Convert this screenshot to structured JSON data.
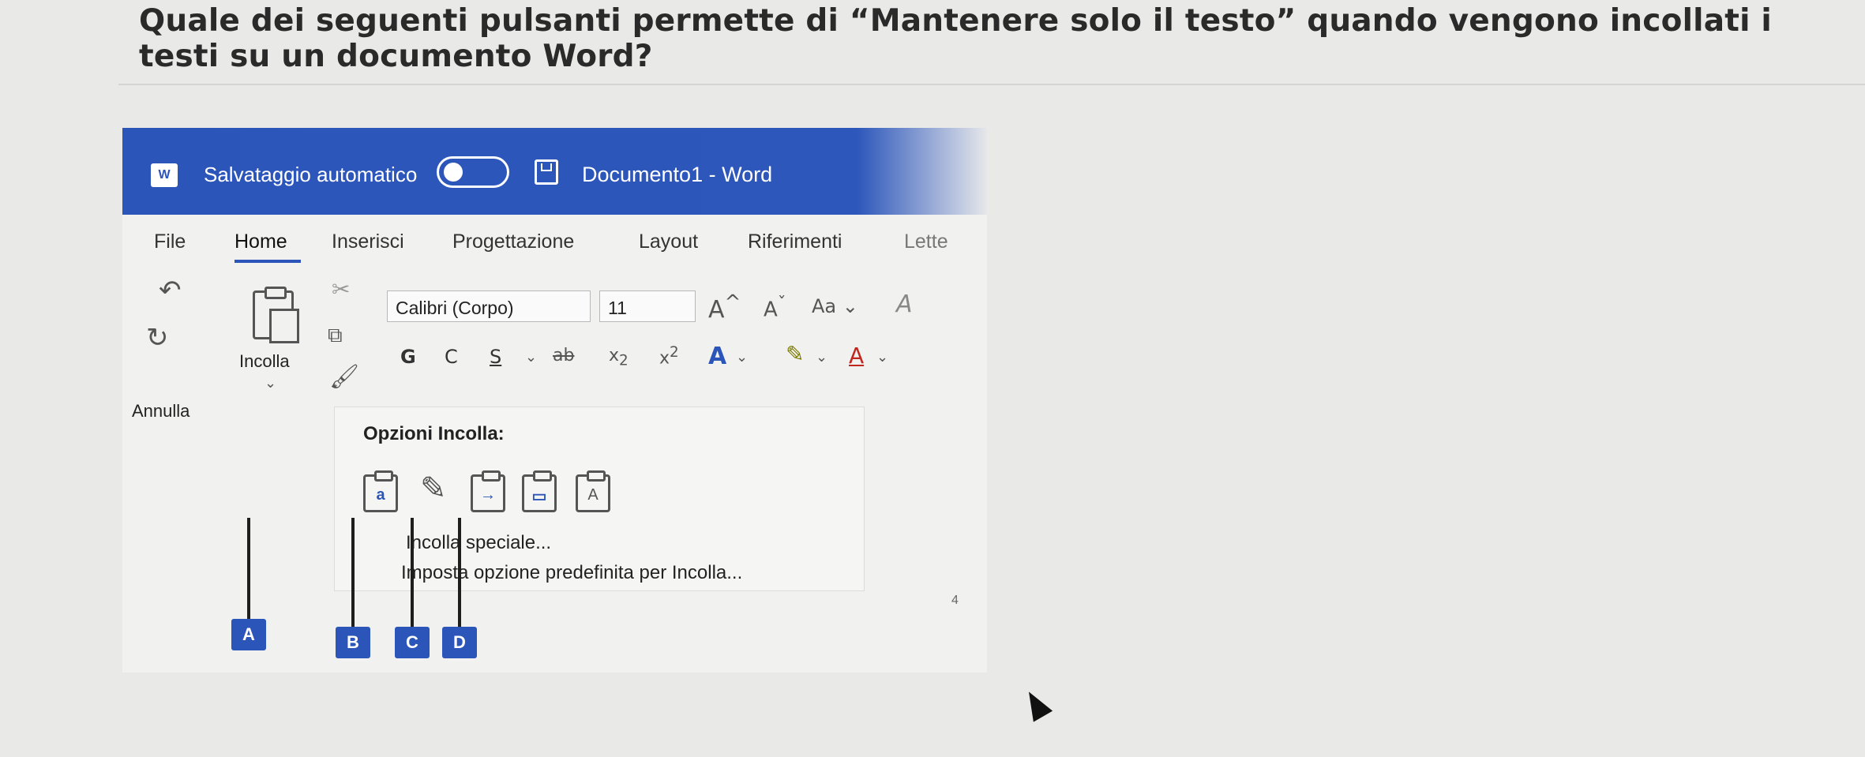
{
  "question": "Quale dei seguenti pulsanti permette di “Mantenere solo il testo” quando vengono incollati i testi su un documento Word?",
  "titlebar": {
    "app_icon": "W",
    "autosave_label": "Salvataggio automatico",
    "document_title": "Documento1  -  Word",
    "accent_color": "#2b55b9"
  },
  "menu": {
    "items": [
      "File",
      "Home",
      "Inserisci",
      "Progettazione",
      "Layout",
      "Riferimenti",
      "Lette"
    ],
    "active": "Home"
  },
  "ribbon": {
    "paste_label": "Incolla",
    "undo_label": "Annulla",
    "font_name": "Calibri (Corpo)",
    "font_size": "11",
    "case_label": "Aa",
    "bold": "G",
    "italic": "C",
    "underline": "S"
  },
  "paste_panel": {
    "title": "Opzioni Incolla:",
    "special": "Incolla speciale...",
    "default": "Imposta opzione predefinita per Incolla..."
  },
  "markers": [
    "A",
    "B",
    "C",
    "D"
  ],
  "ruler": "4"
}
